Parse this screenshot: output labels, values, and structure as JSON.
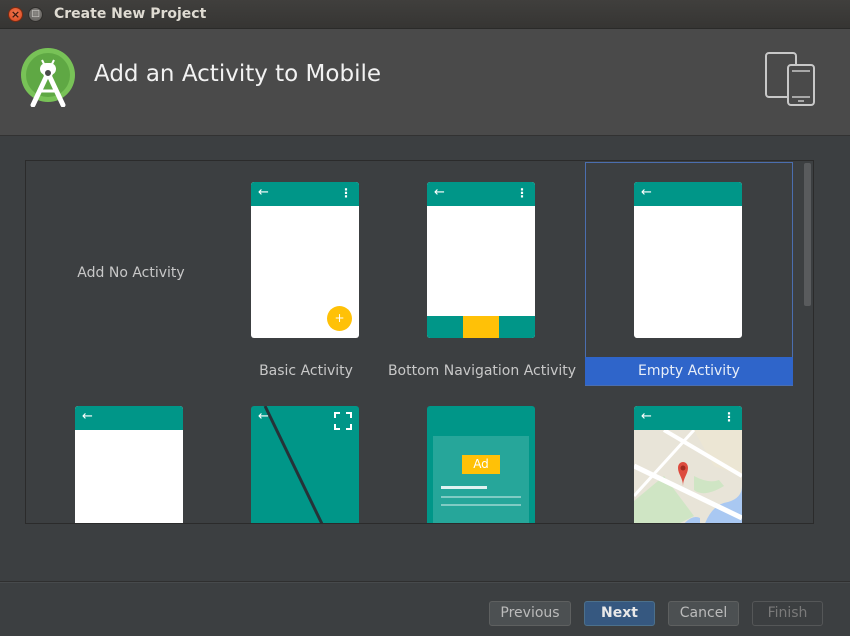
{
  "window": {
    "title": "Create New Project"
  },
  "header": {
    "title": "Add an Activity to Mobile",
    "logo_icon": "android-studio-logo-icon",
    "device_icon": "phone-tablet-devices-icon"
  },
  "gallery": {
    "no_activity_label": "Add No Activity",
    "tiles": [
      {
        "label": "Basic Activity"
      },
      {
        "label": "Bottom Navigation Activity"
      },
      {
        "label": "Empty Activity",
        "selected": true
      }
    ],
    "ad_label": "Ad",
    "icons": {
      "back": "←",
      "menu": "⋮",
      "fab": "+"
    }
  },
  "footer": {
    "previous": "Previous",
    "next": "Next",
    "cancel": "Cancel",
    "finish": "Finish"
  },
  "colors": {
    "teal": "#009688",
    "accent_selection": "#2f65ca",
    "fab": "#ffc107"
  }
}
